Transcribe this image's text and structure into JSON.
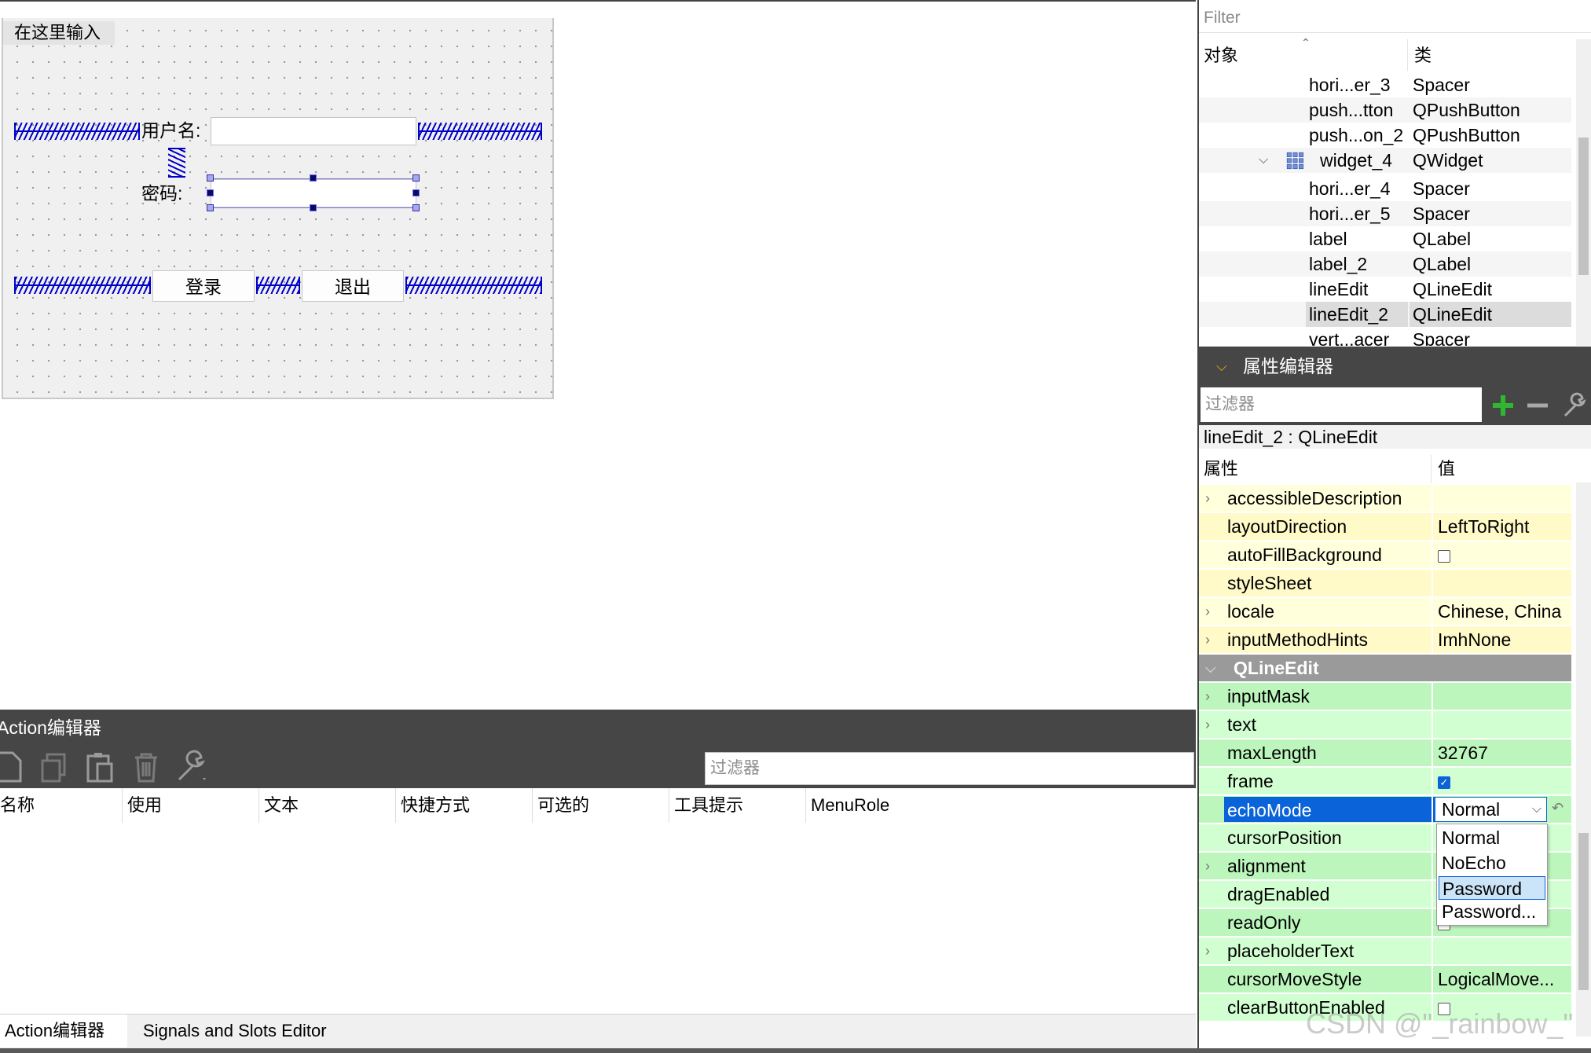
{
  "form": {
    "title": "在这里输入",
    "username_label": "用户名:",
    "password_label": "密码:",
    "login_button": "登录",
    "exit_button": "退出"
  },
  "action_editor": {
    "title": "Action编辑器",
    "filter_placeholder": "过滤器",
    "toolbar_icons": [
      "new-icon",
      "copy-icon",
      "paste-icon",
      "delete-icon",
      "wrench-icon"
    ],
    "columns": [
      "名称",
      "使用",
      "文本",
      "快捷方式",
      "可选的",
      "工具提示",
      "MenuRole"
    ]
  },
  "bottom_tabs": [
    "Action编辑器",
    "Signals and Slots Editor"
  ],
  "object_inspector": {
    "filter_placeholder": "Filter",
    "col_object": "对象",
    "col_class": "类",
    "rows": [
      {
        "name": "hori...er_3",
        "class": "Spacer"
      },
      {
        "name": "push...tton",
        "class": "QPushButton"
      },
      {
        "name": "push...on_2",
        "class": "QPushButton"
      },
      {
        "name": "widget_4",
        "class": "QWidget"
      },
      {
        "name": "hori...er_4",
        "class": "Spacer"
      },
      {
        "name": "hori...er_5",
        "class": "Spacer"
      },
      {
        "name": "label",
        "class": "QLabel"
      },
      {
        "name": "label_2",
        "class": "QLabel"
      },
      {
        "name": "lineEdit",
        "class": "QLineEdit"
      },
      {
        "name": "lineEdit_2",
        "class": "QLineEdit"
      },
      {
        "name": "vert...acer",
        "class": "Spacer"
      }
    ]
  },
  "property_editor": {
    "title": "属性编辑器",
    "filter_placeholder": "过滤器",
    "object_line": "lineEdit_2 : QLineEdit",
    "col_property": "属性",
    "col_value": "值",
    "rows": [
      {
        "name": "accessibleDescription",
        "value": ""
      },
      {
        "name": "layoutDirection",
        "value": "LeftToRight"
      },
      {
        "name": "autoFillBackground",
        "value": ""
      },
      {
        "name": "styleSheet",
        "value": ""
      },
      {
        "name": "locale",
        "value": "Chinese, China"
      },
      {
        "name": "inputMethodHints",
        "value": "ImhNone"
      },
      {
        "name": "QLineEdit",
        "value": ""
      },
      {
        "name": "inputMask",
        "value": ""
      },
      {
        "name": "text",
        "value": ""
      },
      {
        "name": "maxLength",
        "value": "32767"
      },
      {
        "name": "frame",
        "value": ""
      },
      {
        "name": "echoMode",
        "value": ""
      },
      {
        "name": "cursorPosition",
        "value": ""
      },
      {
        "name": "alignment",
        "value": "...a..."
      },
      {
        "name": "dragEnabled",
        "value": ""
      },
      {
        "name": "readOnly",
        "value": ""
      },
      {
        "name": "placeholderText",
        "value": ""
      },
      {
        "name": "cursorMoveStyle",
        "value": "LogicalMove..."
      },
      {
        "name": "clearButtonEnabled",
        "value": ""
      }
    ],
    "echo_mode_selected": "Normal",
    "echo_mode_options": [
      "Normal",
      "NoEcho",
      "Password",
      "Password..."
    ]
  },
  "colors": {
    "dock_title_bg": "#464646",
    "selection_blue": "#0a63d8",
    "row_yellow": "#ffffdc",
    "row_yellow_alt": "#fffac8",
    "row_green": "#d2ffd2",
    "row_green_alt": "#bdf6bd",
    "section_gray": "#9a9a9a",
    "spacer_blue": "#0000c8"
  },
  "watermark": "CSDN @\"_rainbow_\""
}
